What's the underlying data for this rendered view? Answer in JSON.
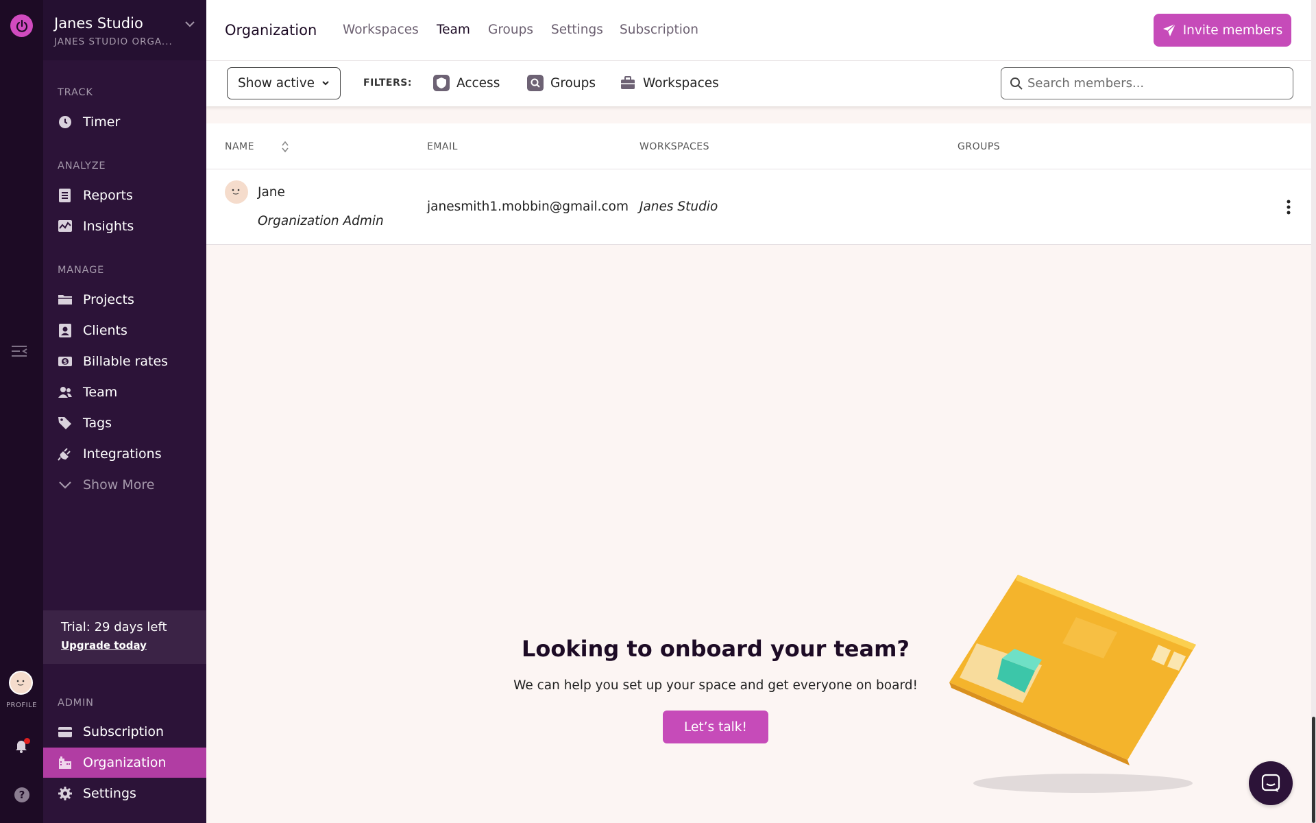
{
  "org": {
    "name": "Janes Studio",
    "subtitle": "JANES STUDIO ORGA..."
  },
  "sidebar": {
    "sections": {
      "track": "TRACK",
      "analyze": "ANALYZE",
      "manage": "MANAGE",
      "admin": "ADMIN"
    },
    "items": [
      {
        "label": "Timer",
        "icon": "clock-icon"
      },
      {
        "label": "Reports",
        "icon": "reports-icon"
      },
      {
        "label": "Insights",
        "icon": "insights-icon"
      },
      {
        "label": "Projects",
        "icon": "folder-icon"
      },
      {
        "label": "Clients",
        "icon": "client-icon"
      },
      {
        "label": "Billable rates",
        "icon": "dollar-icon"
      },
      {
        "label": "Team",
        "icon": "team-icon"
      },
      {
        "label": "Tags",
        "icon": "tag-icon"
      },
      {
        "label": "Integrations",
        "icon": "plug-icon"
      },
      {
        "label": "Show More",
        "icon": "chevron-down-icon"
      }
    ],
    "admin_items": [
      {
        "label": "Subscription",
        "icon": "card-icon"
      },
      {
        "label": "Organization",
        "icon": "building-icon"
      },
      {
        "label": "Settings",
        "icon": "gear-icon"
      }
    ],
    "trial_text": "Trial: 29 days left",
    "upgrade_link": "Upgrade today"
  },
  "rail": {
    "profile_label": "PROFILE"
  },
  "header": {
    "title": "Organization",
    "tabs": [
      "Workspaces",
      "Team",
      "Groups",
      "Settings",
      "Subscription"
    ],
    "active_tab": "Team",
    "invite_label": "Invite members"
  },
  "filters": {
    "status_select": "Show active",
    "label": "FILTERS:",
    "chips": [
      "Access",
      "Groups",
      "Workspaces"
    ],
    "search_placeholder": "Search members..."
  },
  "table": {
    "columns": [
      "NAME",
      "EMAIL",
      "WORKSPACES",
      "GROUPS"
    ],
    "rows": [
      {
        "name": "Jane",
        "role": "Organization Admin",
        "email": "janesmith1.mobbin@gmail.com",
        "workspaces": "Janes Studio",
        "groups": ""
      }
    ]
  },
  "onboarding": {
    "title": "Looking to onboard your team?",
    "text": "We can help you set up your space and get everyone on board!",
    "button": "Let’s talk!"
  },
  "colors": {
    "brand": "#c64bb9",
    "sidebar_bg": "#2c1338",
    "rail_bg": "#1d0b25",
    "background": "#fcf5f3"
  }
}
